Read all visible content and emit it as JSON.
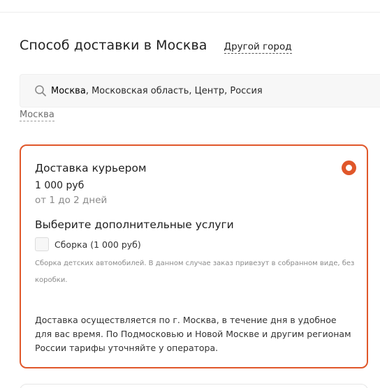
{
  "header": {
    "title": "Способ доставки в Москва",
    "other_city_label": "Другой город"
  },
  "search": {
    "icon": "search-icon",
    "highlight": "Москва",
    "rest": ", Московская область, Центр, Россия"
  },
  "city_link": "Москва",
  "delivery_option": {
    "title": "Доставка курьером",
    "price": "1 000 руб",
    "term": "от 1 до 2 дней",
    "selected": true,
    "accent_color": "#e0572a",
    "extras_title": "Выберите дополнительные услуги",
    "extras": [
      {
        "label": "Сборка (1 000 руб)",
        "checked": false,
        "note": "Сборка детских автомобилей. В данном случае заказ привезут в собранном виде, без коробки."
      }
    ],
    "info": "Доставка осуществляется по г. Москва, в течение дня в удобное для вас время. По Подмосковью и Новой Москве и другим регионам России тарифы уточняйте у оператора."
  }
}
